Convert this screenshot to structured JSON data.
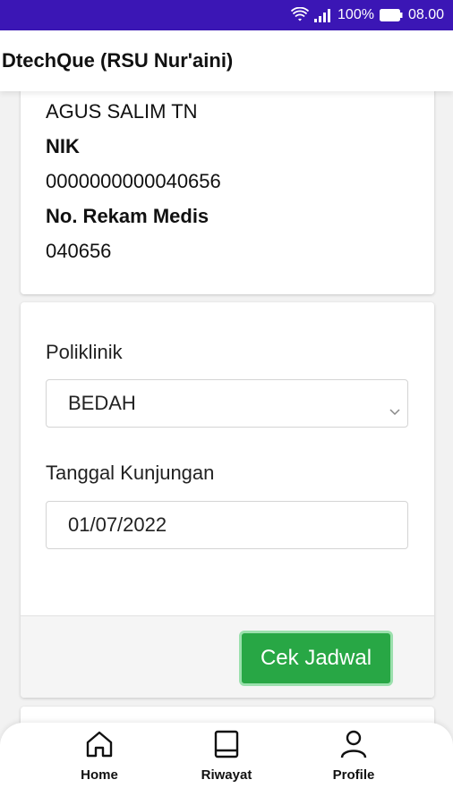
{
  "status_bar": {
    "battery": "100%",
    "time": "08.00"
  },
  "app_bar": {
    "title": "DtechQue (RSU Nur'aini)"
  },
  "patient": {
    "name": "AGUS SALIM TN",
    "nik_label": "NIK",
    "nik_value": "0000000000040656",
    "rm_label": "No. Rekam Medis",
    "rm_value": "040656"
  },
  "form": {
    "poliklinik_label": "Poliklinik",
    "poliklinik_value": "BEDAH",
    "tanggal_label": "Tanggal Kunjungan",
    "tanggal_value": "01/07/2022",
    "submit_label": "Cek Jadwal"
  },
  "bottom_nav": {
    "items": [
      {
        "label": "Home",
        "icon": "home-icon"
      },
      {
        "label": "Riwayat",
        "icon": "book-icon"
      },
      {
        "label": "Profile",
        "icon": "person-icon"
      }
    ]
  },
  "colors": {
    "status_bar": "#3b16b5",
    "button": "#28a745"
  }
}
